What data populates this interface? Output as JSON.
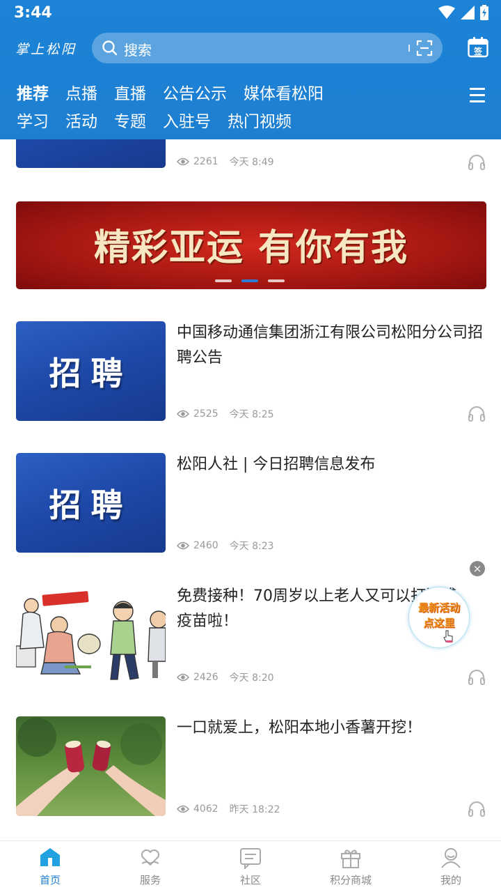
{
  "status_bar": {
    "time": "3:44",
    "icons": [
      "wifi-icon",
      "signal-icon",
      "battery-icon"
    ]
  },
  "header": {
    "logo": "掌上松阳",
    "search_placeholder": "搜索",
    "nav_row1": [
      {
        "label": "推荐",
        "active": true
      },
      {
        "label": "点播"
      },
      {
        "label": "直播"
      },
      {
        "label": "公告公示"
      },
      {
        "label": "媒体看松阳"
      }
    ],
    "nav_row2": [
      {
        "label": "学习"
      },
      {
        "label": "活动"
      },
      {
        "label": "专题"
      },
      {
        "label": "入驻号"
      },
      {
        "label": "热门视频"
      }
    ],
    "colors": {
      "primary": "#1d7fd2"
    }
  },
  "feed": {
    "partial_item": {
      "views": "2261",
      "time": "今天 8:49"
    },
    "banner": {
      "text": "精彩亚运 有你有我",
      "active_dot": 1,
      "dot_count": 3
    },
    "items": [
      {
        "title": "中国移动通信集团浙江有限公司松阳分公司招聘公告",
        "thumb_text": "招聘",
        "views": "2525",
        "time": "今天 8:25"
      },
      {
        "title": "松阳人社 | 今日招聘信息发布",
        "thumb_text": "招聘",
        "views": "2460",
        "time": "今天 8:23"
      },
      {
        "title": "免费接种！70周岁以上老人又可以打流感疫苗啦！",
        "views": "2426",
        "time": "今天 8:20"
      },
      {
        "title": "一口就爱上，松阳本地小香薯开挖！",
        "views": "4062",
        "time": "昨天 18:22"
      }
    ]
  },
  "floating_ad": {
    "line1": "最新活动",
    "line2": "点这里"
  },
  "tabbar": [
    {
      "label": "首页",
      "icon": "home-icon",
      "active": true
    },
    {
      "label": "服务",
      "icon": "heart-hand-icon"
    },
    {
      "label": "社区",
      "icon": "chat-icon"
    },
    {
      "label": "积分商城",
      "icon": "gift-icon"
    },
    {
      "label": "我的",
      "icon": "user-icon"
    }
  ]
}
